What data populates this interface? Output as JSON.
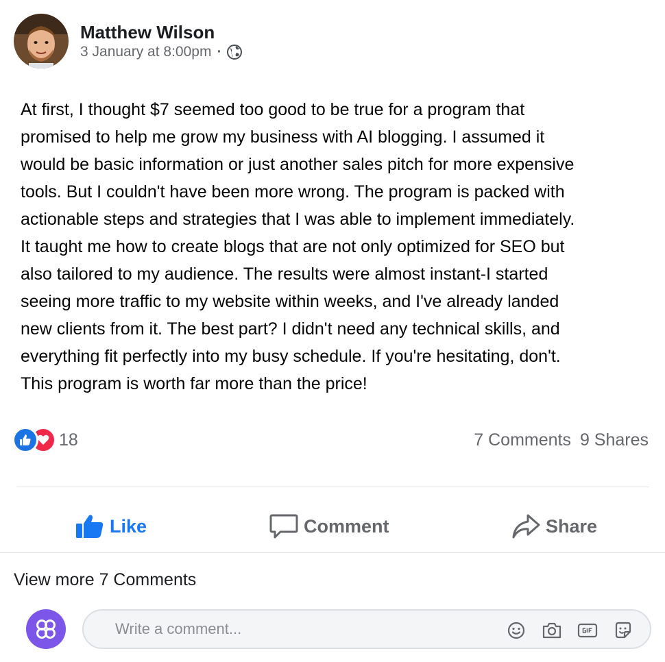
{
  "post": {
    "author": "Matthew Wilson",
    "timestamp": "3 January at 8:00pm",
    "separator": "·",
    "privacy_icon": "globe-icon",
    "body_lines": [
      "At first, I thought $7 seemed too good to be true for a program that",
      "promised to help me grow my business with AI blogging. I assumed it",
      "would be basic information or just another sales pitch for more expensive",
      "tools. But I couldn't have been more wrong. The program is packed with",
      "actionable steps and strategies that I was able to implement immediately.",
      "It taught me how to create blogs that are not only optimized for SEO but",
      "also tailored to my audience. The results were almost instant-I started",
      "seeing more traffic to my website within weeks, and I've already landed",
      "new clients from it. The best part? I didn't need any technical skills, and",
      "everything fit perfectly into my busy schedule. If you're hesitating, don't.",
      "This program is worth far more than the price!"
    ]
  },
  "reactions": {
    "icons": [
      "thumbs-up-icon",
      "heart-icon"
    ],
    "count": "18",
    "comments": "7 Comments",
    "shares": "9 Shares"
  },
  "actions": {
    "like": "Like",
    "comment": "Comment",
    "share": "Share"
  },
  "view_more": "View more 7 Comments",
  "composer": {
    "placeholder": "Write a comment...",
    "tools": [
      "emoji-icon",
      "camera-icon",
      "gif-icon",
      "sticker-icon"
    ]
  },
  "colors": {
    "like_blue": "#1877f2",
    "love_red": "#f02849",
    "muted_text": "#65676b",
    "composer_avatar": "#7c56e8"
  }
}
